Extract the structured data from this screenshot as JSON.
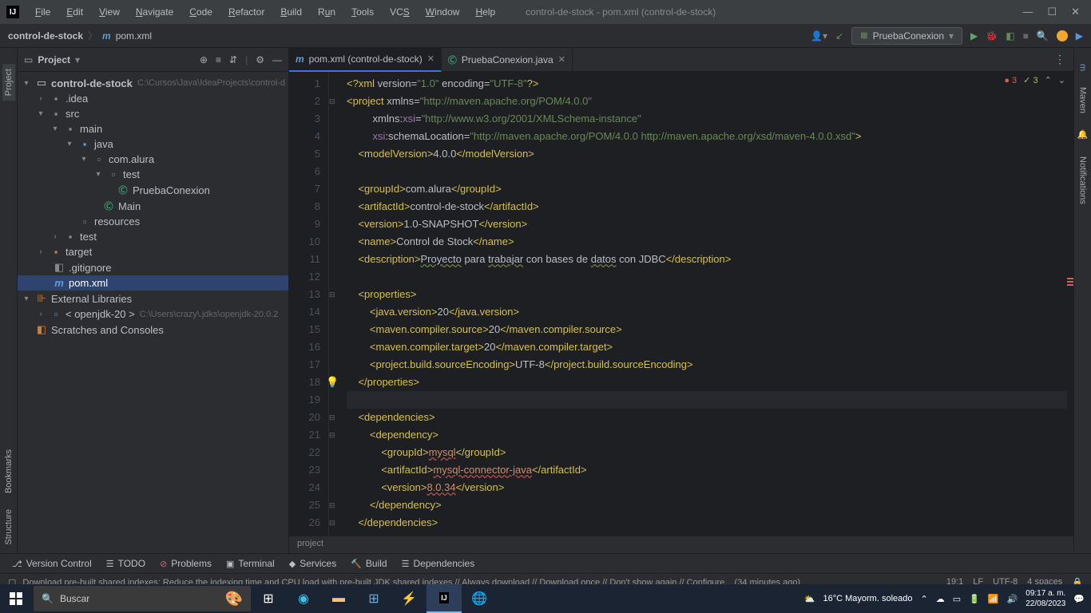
{
  "window": {
    "title": "control-de-stock - pom.xml (control-de-stock)"
  },
  "menu": {
    "file": "File",
    "edit": "Edit",
    "view": "View",
    "navigate": "Navigate",
    "code": "Code",
    "refactor": "Refactor",
    "build": "Build",
    "run": "Run",
    "tools": "Tools",
    "vcs": "VCS",
    "window": "Window",
    "help": "Help"
  },
  "breadcrumb": {
    "root": "control-de-stock",
    "file": "pom.xml"
  },
  "runConfig": "PruebaConexion",
  "projectTool": {
    "title": "Project",
    "rootName": "control-de-stock",
    "rootPath": "C:\\Cursos\\Java\\IdeaProjects\\control-d",
    "idea": ".idea",
    "src": "src",
    "main": "main",
    "java": "java",
    "pkg": "com.alura",
    "test": "test",
    "pc": "PruebaConexion",
    "mainClass": "Main",
    "resources": "resources",
    "testDir": "test",
    "target": "target",
    "gitignore": ".gitignore",
    "pom": "pom.xml",
    "extLib": "External Libraries",
    "jdk": "< openjdk-20 >",
    "jdkPath": "C:\\Users\\crazy\\.jdks\\openjdk-20.0.2",
    "scratch": "Scratches and Consoles"
  },
  "tabs": {
    "t1": "pom.xml (control-de-stock)",
    "t2": "PruebaConexion.java"
  },
  "inspection": {
    "errors": "3",
    "warnings": "3"
  },
  "crumbBottom": "project",
  "bottomTools": {
    "vc": "Version Control",
    "todo": "TODO",
    "problems": "Problems",
    "terminal": "Terminal",
    "services": "Services",
    "build": "Build",
    "deps": "Dependencies"
  },
  "statusMsg": "Download pre-built shared indexes: Reduce the indexing time and CPU load with pre-built JDK shared indexes // Always download // Download once // Don't show again // Configure... (34 minutes ago)",
  "statusR": {
    "pos": "19:1",
    "le": "LF",
    "enc": "UTF-8",
    "ind": "4 spaces"
  },
  "taskbar": {
    "search": "Buscar",
    "weather": "16°C  Mayorm. soleado",
    "time": "09:17 a. m.",
    "date": "22/08/2023"
  },
  "rightTools": {
    "maven": "Maven",
    "notif": "Notifications"
  },
  "leftTools": {
    "project": "Project",
    "bookmarks": "Bookmarks",
    "structure": "Structure"
  }
}
